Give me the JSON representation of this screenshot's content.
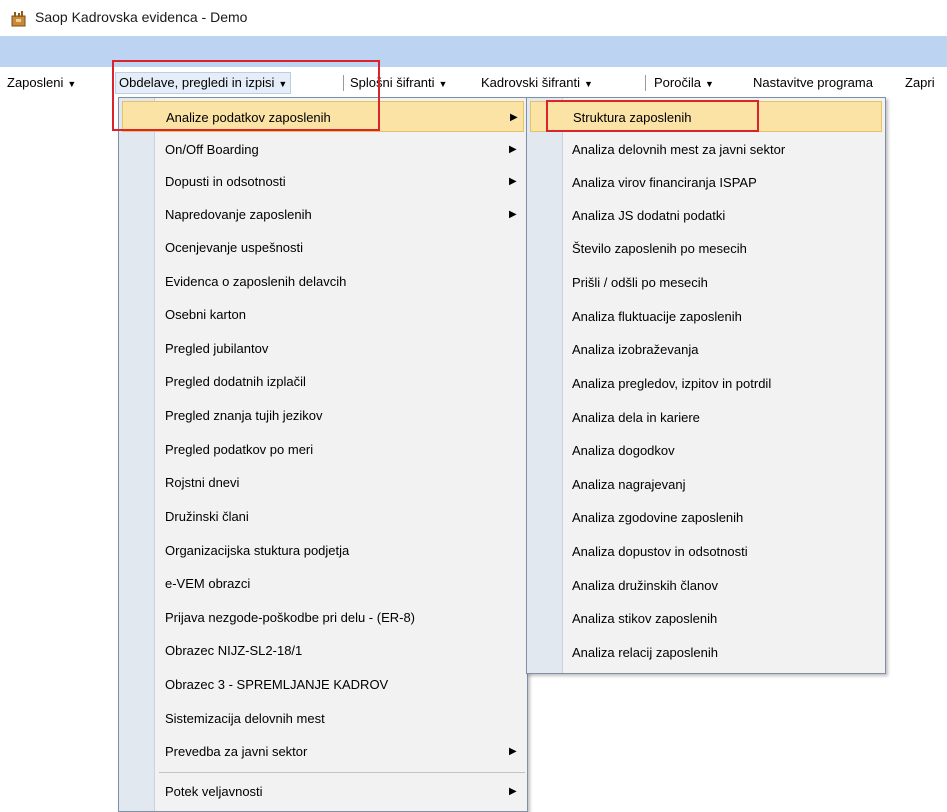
{
  "window": {
    "title": "Saop Kadrovska evidenca  - Demo"
  },
  "menubar": {
    "items": [
      {
        "label": "Zaposleni"
      },
      {
        "label": "Obdelave, pregledi in izpisi"
      },
      {
        "label": "Splošni šifranti"
      },
      {
        "label": "Kadrovski šifranti"
      },
      {
        "label": "Poročila"
      },
      {
        "label": "Nastavitve programa"
      },
      {
        "label": "Zapri"
      }
    ]
  },
  "menu_main": {
    "items": [
      {
        "label": "Analize podatkov zaposlenih",
        "submenu": true
      },
      {
        "label": "On/Off Boarding",
        "submenu": true
      },
      {
        "label": "Dopusti in odsotnosti",
        "submenu": true
      },
      {
        "label": "Napredovanje zaposlenih",
        "submenu": true
      },
      {
        "label": "Ocenjevanje uspešnosti"
      },
      {
        "label": "Evidenca o zaposlenih delavcih"
      },
      {
        "label": "Osebni karton"
      },
      {
        "label": "Pregled jubilantov"
      },
      {
        "label": "Pregled dodatnih izplačil"
      },
      {
        "label": "Pregled znanja tujih jezikov"
      },
      {
        "label": "Pregled podatkov po meri"
      },
      {
        "label": "Rojstni dnevi"
      },
      {
        "label": "Družinski člani"
      },
      {
        "label": "Organizacijska stuktura podjetja"
      },
      {
        "label": "e-VEM obrazci"
      },
      {
        "label": "Prijava nezgode-poškodbe pri delu - (ER-8)"
      },
      {
        "label": "Obrazec NIJZ-SL2-18/1"
      },
      {
        "label": "Obrazec 3 - SPREMLJANJE KADROV"
      },
      {
        "label": "Sistemizacija delovnih mest"
      },
      {
        "label": "Prevedba za javni sektor",
        "submenu": true
      },
      {
        "label": "Potek veljavnosti",
        "submenu": true
      }
    ]
  },
  "menu_sub": {
    "items": [
      {
        "label": "Struktura zaposlenih"
      },
      {
        "label": "Analiza delovnih mest za javni sektor"
      },
      {
        "label": "Analiza virov financiranja ISPAP"
      },
      {
        "label": "Analiza JS dodatni podatki"
      },
      {
        "label": "Število zaposlenih po mesecih"
      },
      {
        "label": "Prišli / odšli po mesecih"
      },
      {
        "label": "Analiza fluktuacije zaposlenih"
      },
      {
        "label": "Analiza izobraževanja"
      },
      {
        "label": "Analiza pregledov, izpitov in potrdil"
      },
      {
        "label": "Analiza dela in kariere"
      },
      {
        "label": "Analiza dogodkov"
      },
      {
        "label": "Analiza nagrajevanj"
      },
      {
        "label": "Analiza zgodovine zaposlenih"
      },
      {
        "label": "Analiza dopustov in odsotnosti"
      },
      {
        "label": "Analiza družinskih članov"
      },
      {
        "label": "Analiza stikov zaposlenih"
      },
      {
        "label": "Analiza relacij zaposlenih"
      }
    ]
  },
  "colors": {
    "highlight": "#fbe3a5",
    "callout": "#d9242e",
    "band": "#bcd3f2"
  }
}
